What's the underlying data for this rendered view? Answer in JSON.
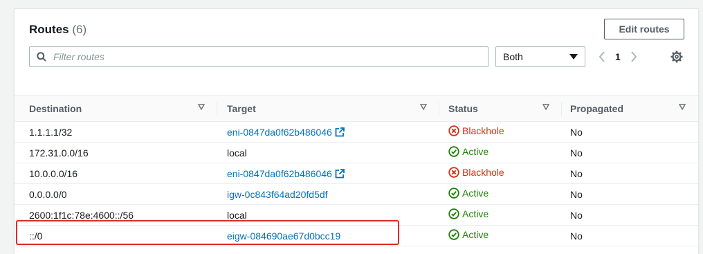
{
  "routes": {
    "title": "Routes",
    "count": "(6)",
    "edit_button": "Edit routes",
    "filter": {
      "placeholder": "Filter routes",
      "value": ""
    },
    "propagation_select": {
      "selected": "Both"
    },
    "pagination": {
      "current_page": "1"
    },
    "columns": {
      "destination": "Destination",
      "target": "Target",
      "status": "Status",
      "propagated": "Propagated"
    },
    "rows": [
      {
        "destination": "1.1.1.1/32",
        "target": "eni-0847da0f62b486046",
        "target_link": true,
        "external": true,
        "status": "Blackhole",
        "status_kind": "blackhole",
        "propagated": "No"
      },
      {
        "destination": "172.31.0.0/16",
        "target": "local",
        "target_link": false,
        "external": false,
        "status": "Active",
        "status_kind": "active",
        "propagated": "No"
      },
      {
        "destination": "10.0.0.0/16",
        "target": "eni-0847da0f62b486046",
        "target_link": true,
        "external": true,
        "status": "Blackhole",
        "status_kind": "blackhole",
        "propagated": "No"
      },
      {
        "destination": "0.0.0.0/0",
        "target": "igw-0c843f64ad20fd5df",
        "target_link": true,
        "external": false,
        "status": "Active",
        "status_kind": "active",
        "propagated": "No"
      },
      {
        "destination": "2600:1f1c:78e:4600::/56",
        "target": "local",
        "target_link": false,
        "external": false,
        "status": "Active",
        "status_kind": "active",
        "propagated": "No"
      },
      {
        "destination": "::/0",
        "target": "eigw-084690ae67d0bcc19",
        "target_link": true,
        "external": false,
        "status": "Active",
        "status_kind": "active",
        "propagated": "No"
      }
    ]
  },
  "colors": {
    "link": "#0073bb",
    "active": "#1d8102",
    "blackhole": "#d13212",
    "highlight": "#e0282a"
  }
}
